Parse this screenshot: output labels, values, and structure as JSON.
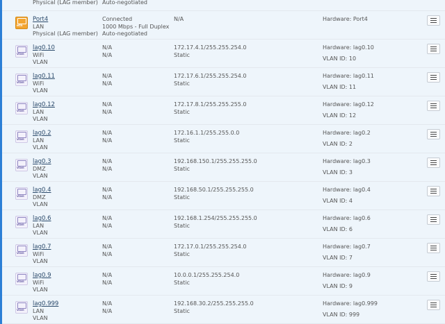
{
  "partial_row": {
    "type": "Physical (LAG member)",
    "status": "Auto-negotiated"
  },
  "rows": [
    {
      "name": "Port4",
      "zone": "LAN",
      "type": "Physical (LAG member)",
      "icon": "ethernet-icon",
      "icon_tag": "eth",
      "status1": "Connected",
      "status2": "1000 Mbps - Full Duplex",
      "status3": "Auto-negotiated",
      "ip1": "N/A",
      "ip2": "",
      "hardware": "Hardware:  Port4",
      "vlan": ""
    },
    {
      "name": "lag0.10",
      "zone": "WiFi",
      "type": "VLAN",
      "icon": "vlan-icon",
      "icon_tag": "vlan",
      "status1": "N/A",
      "status2": "N/A",
      "status3": "",
      "ip1": "172.17.4.1/255.255.254.0",
      "ip2": "Static",
      "hardware": "Hardware:  lag0.10",
      "vlan": "VLAN ID: 10"
    },
    {
      "name": "lag0.11",
      "zone": "WiFi",
      "type": "VLAN",
      "icon": "vlan-icon",
      "icon_tag": "vlan",
      "status1": "N/A",
      "status2": "N/A",
      "status3": "",
      "ip1": "172.17.6.1/255.255.254.0",
      "ip2": "Static",
      "hardware": "Hardware:  lag0.11",
      "vlan": "VLAN ID: 11"
    },
    {
      "name": "lag0.12",
      "zone": "LAN",
      "type": "VLAN",
      "icon": "vlan-icon",
      "icon_tag": "vlan",
      "status1": "N/A",
      "status2": "N/A",
      "status3": "",
      "ip1": "172.17.8.1/255.255.255.0",
      "ip2": "Static",
      "hardware": "Hardware:  lag0.12",
      "vlan": "VLAN ID: 12"
    },
    {
      "name": "lag0.2",
      "zone": "LAN",
      "type": "VLAN",
      "icon": "vlan-icon",
      "icon_tag": "vlan",
      "status1": "N/A",
      "status2": "N/A",
      "status3": "",
      "ip1": "172.16.1.1/255.255.0.0",
      "ip2": "Static",
      "hardware": "Hardware:  lag0.2",
      "vlan": "VLAN ID: 2"
    },
    {
      "name": "lag0.3",
      "zone": "DMZ",
      "type": "VLAN",
      "icon": "vlan-icon",
      "icon_tag": "vlan",
      "status1": "N/A",
      "status2": "N/A",
      "status3": "",
      "ip1": "192.168.150.1/255.255.255.0",
      "ip2": "Static",
      "hardware": "Hardware:  lag0.3",
      "vlan": "VLAN ID: 3"
    },
    {
      "name": "lag0.4",
      "zone": "DMZ",
      "type": "VLAN",
      "icon": "vlan-icon",
      "icon_tag": "vlan",
      "status1": "N/A",
      "status2": "N/A",
      "status3": "",
      "ip1": "192.168.50.1/255.255.255.0",
      "ip2": "Static",
      "hardware": "Hardware:  lag0.4",
      "vlan": "VLAN ID: 4"
    },
    {
      "name": "lag0.6",
      "zone": "LAN",
      "type": "VLAN",
      "icon": "vlan-icon",
      "icon_tag": "vlan",
      "status1": "N/A",
      "status2": "N/A",
      "status3": "",
      "ip1": "192.168.1.254/255.255.255.0",
      "ip2": "Static",
      "hardware": "Hardware:  lag0.6",
      "vlan": "VLAN ID: 6"
    },
    {
      "name": "lag0.7",
      "zone": "WiFi",
      "type": "VLAN",
      "icon": "vlan-icon",
      "icon_tag": "vlan",
      "status1": "N/A",
      "status2": "N/A",
      "status3": "",
      "ip1": "172.17.0.1/255.255.254.0",
      "ip2": "Static",
      "hardware": "Hardware:  lag0.7",
      "vlan": "VLAN ID: 7"
    },
    {
      "name": "lag0.9",
      "zone": "WiFi",
      "type": "VLAN",
      "icon": "vlan-icon",
      "icon_tag": "vlan",
      "status1": "N/A",
      "status2": "N/A",
      "status3": "",
      "ip1": "10.0.0.1/255.255.254.0",
      "ip2": "Static",
      "hardware": "Hardware:  lag0.9",
      "vlan": "VLAN ID: 9"
    },
    {
      "name": "lag0.999",
      "zone": "LAN",
      "type": "VLAN",
      "icon": "vlan-icon",
      "icon_tag": "vlan",
      "status1": "N/A",
      "status2": "N/A",
      "status3": "",
      "ip1": "192.168.30.2/255.255.255.0",
      "ip2": "Static",
      "hardware": "Hardware:  lag0.999",
      "vlan": "VLAN ID: 999"
    }
  ],
  "menu_icon": "hamburger-menu-icon"
}
